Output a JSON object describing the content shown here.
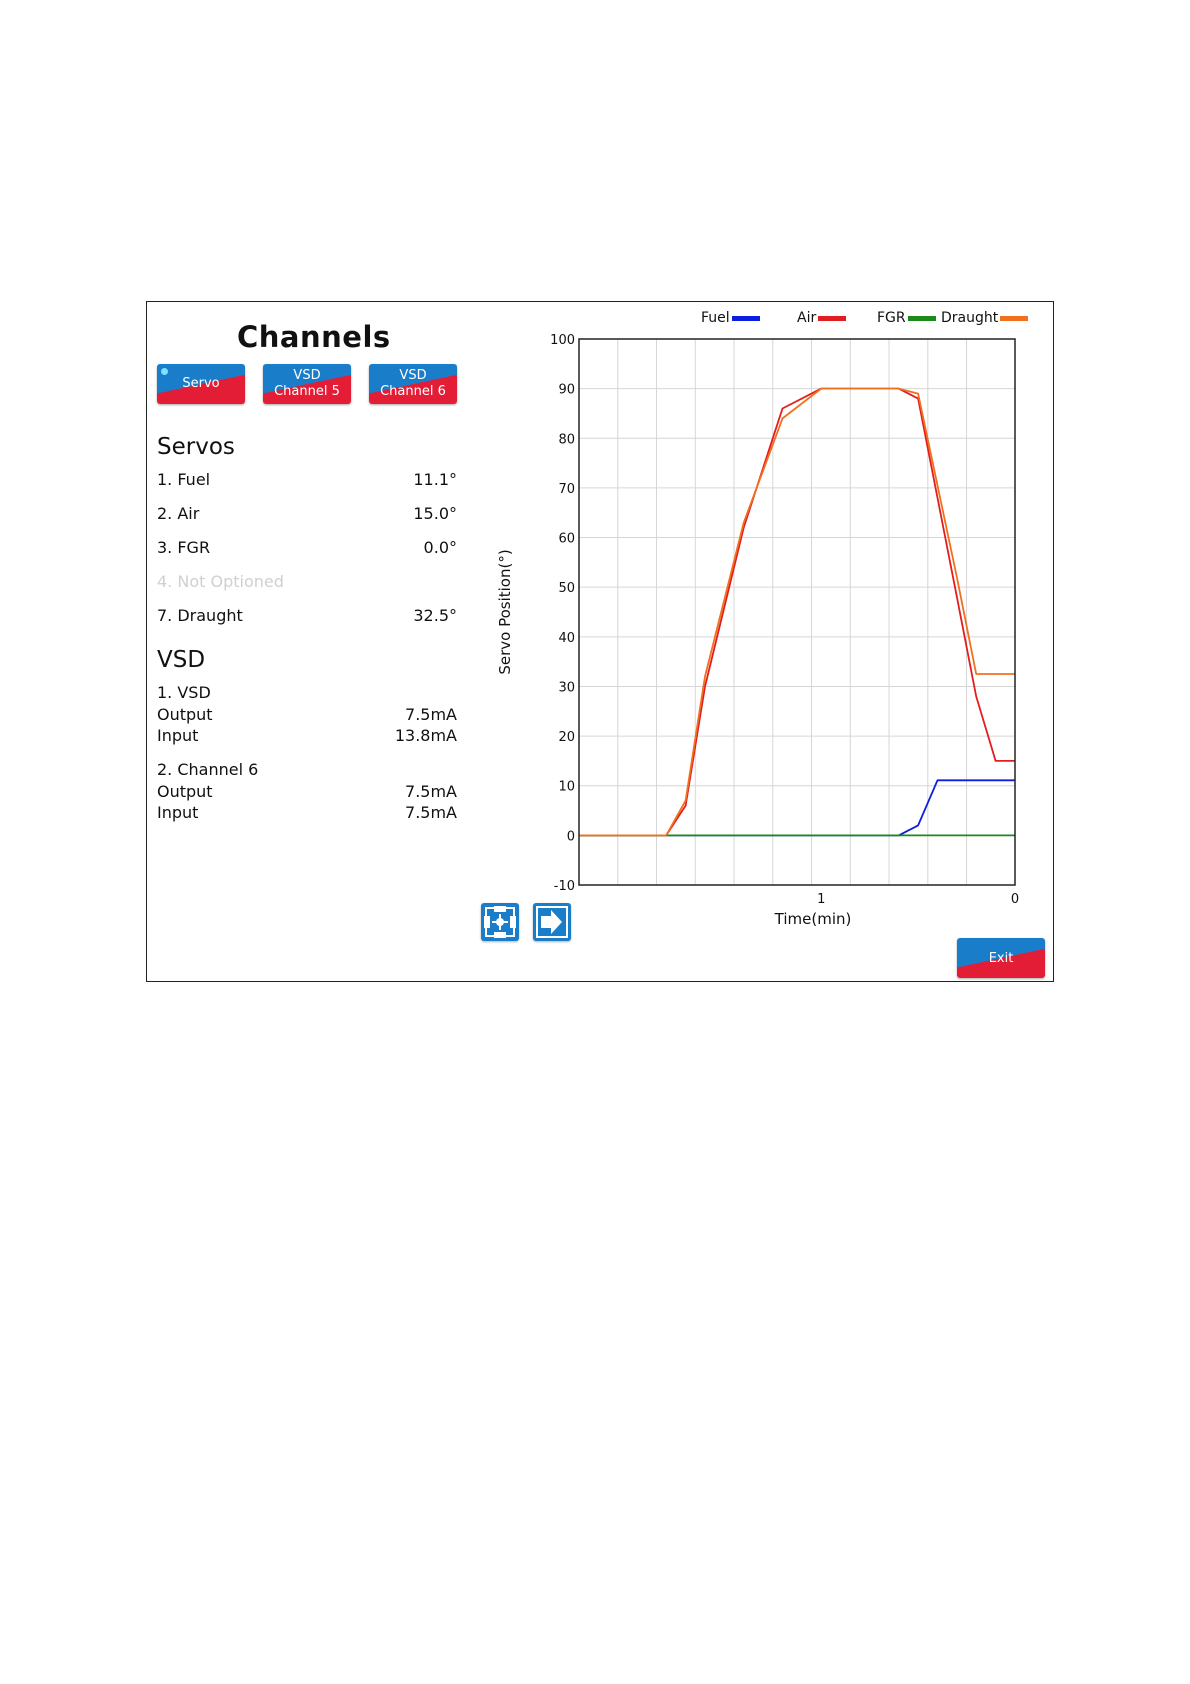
{
  "header": {
    "title": "Channels"
  },
  "tabs": [
    {
      "line1": "Servo",
      "line2": ""
    },
    {
      "line1": "VSD",
      "line2": "Channel 5"
    },
    {
      "line1": "VSD",
      "line2": "Channel 6"
    }
  ],
  "servos": {
    "heading": "Servos",
    "items": [
      {
        "label": "1. Fuel",
        "value": "11.1°"
      },
      {
        "label": "2. Air",
        "value": "15.0°"
      },
      {
        "label": "3. FGR",
        "value": "0.0°"
      },
      {
        "label": "4. Not Optioned",
        "value": ""
      },
      {
        "label": "7. Draught",
        "value": "32.5°"
      }
    ]
  },
  "vsd": {
    "heading": "VSD",
    "ch1": {
      "label": "1. VSD",
      "output_label": "Output",
      "output": "7.5mA",
      "input_label": "Input",
      "input": "13.8mA"
    },
    "ch2": {
      "label": "2. Channel 6",
      "output_label": "Output",
      "output": "7.5mA",
      "input_label": "Input",
      "input": "7.5mA"
    }
  },
  "exit_label": "Exit",
  "icons": {
    "center": "center-view-icon",
    "next": "next-arrow-icon"
  },
  "chart_data": {
    "type": "line",
    "xlabel": "Time(min)",
    "ylabel": "Servo Position(°)",
    "ylim": [
      -10,
      100
    ],
    "xlim": [
      2.25,
      0
    ],
    "x_ticks": [
      1,
      0
    ],
    "y_ticks": [
      -10,
      0,
      10,
      20,
      30,
      40,
      50,
      60,
      70,
      80,
      90,
      100
    ],
    "grid": true,
    "legend_position": "top-right",
    "series": [
      {
        "name": "Fuel",
        "color": "#0b1fe0",
        "points": [
          [
            2.25,
            0
          ],
          [
            0.6,
            0
          ],
          [
            0.5,
            2
          ],
          [
            0.4,
            11.1
          ],
          [
            0,
            11.1
          ]
        ]
      },
      {
        "name": "Air",
        "color": "#e31d1d",
        "points": [
          [
            2.25,
            0
          ],
          [
            1.8,
            0
          ],
          [
            1.7,
            6
          ],
          [
            1.6,
            30
          ],
          [
            1.4,
            62
          ],
          [
            1.2,
            86
          ],
          [
            1.0,
            90
          ],
          [
            0.6,
            90
          ],
          [
            0.5,
            88
          ],
          [
            0.3,
            48
          ],
          [
            0.2,
            28
          ],
          [
            0.1,
            15
          ],
          [
            0,
            15
          ]
        ]
      },
      {
        "name": "FGR",
        "color": "#1a8a1a",
        "points": [
          [
            2.25,
            0
          ],
          [
            0,
            0
          ]
        ]
      },
      {
        "name": "Draught",
        "color": "#f07020",
        "points": [
          [
            2.25,
            0
          ],
          [
            1.8,
            0
          ],
          [
            1.7,
            7
          ],
          [
            1.6,
            32
          ],
          [
            1.4,
            63
          ],
          [
            1.2,
            84
          ],
          [
            1.0,
            90
          ],
          [
            0.6,
            90
          ],
          [
            0.5,
            89
          ],
          [
            0.3,
            52
          ],
          [
            0.2,
            32.5
          ],
          [
            0,
            32.5
          ]
        ]
      }
    ]
  }
}
